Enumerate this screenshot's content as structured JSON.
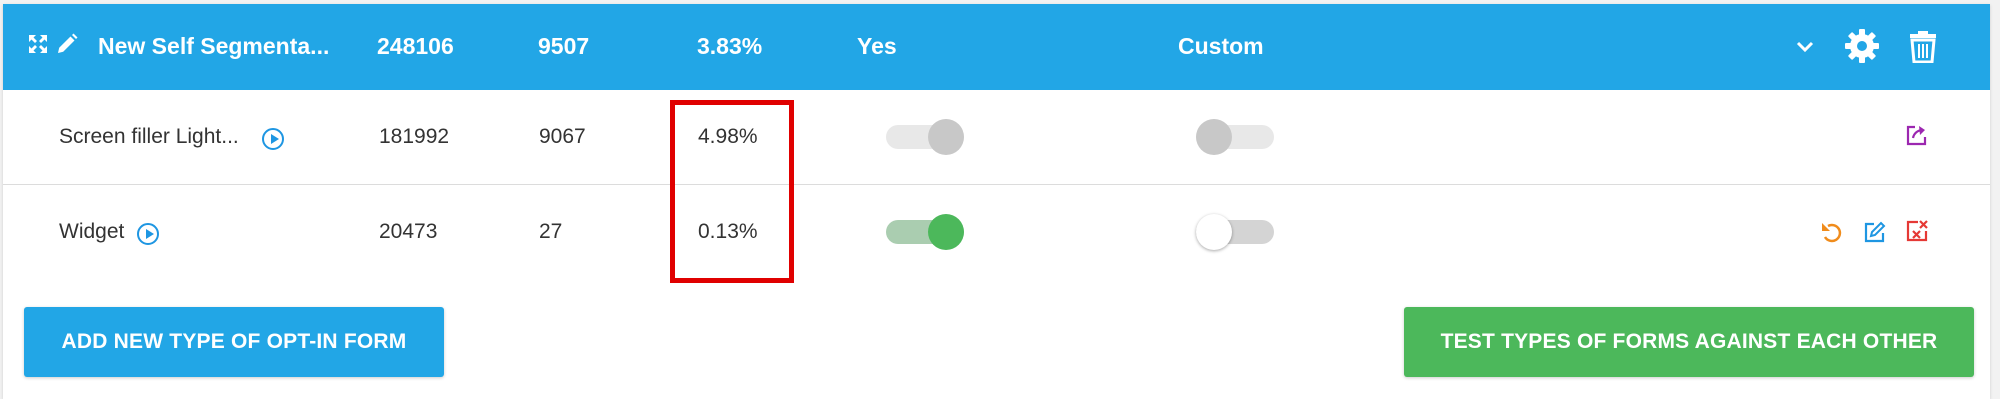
{
  "header": {
    "title": "New Self Segmenta...",
    "visitors": "248106",
    "conversions": "9507",
    "rate": "3.83%",
    "active": "Yes",
    "segment": "Custom",
    "color": "#22a6e6"
  },
  "rows": [
    {
      "name": "Screen filler Light...",
      "visitors": "181992",
      "conversions": "9067",
      "rate": "4.98%",
      "active_toggle": false,
      "custom_toggle": false,
      "actions": [
        "share-icon"
      ]
    },
    {
      "name": "Widget",
      "visitors": "20473",
      "conversions": "27",
      "rate": "0.13%",
      "active_toggle": true,
      "custom_toggle": false,
      "actions": [
        "undo-icon",
        "edit-icon",
        "delete-icon"
      ]
    }
  ],
  "buttons": {
    "add_form": "ADD NEW TYPE OF OPT-IN FORM",
    "test_forms": "TEST TYPES OF FORMS AGAINST EACH OTHER"
  },
  "colors": {
    "primary": "#22a6e6",
    "success": "#4cb85b",
    "toggle_on": "#4cb85b",
    "highlight": "#e00000",
    "undo": "#f08c1c",
    "edit": "#1e96e2",
    "delete": "#e53935",
    "share": "#9c27b0"
  }
}
